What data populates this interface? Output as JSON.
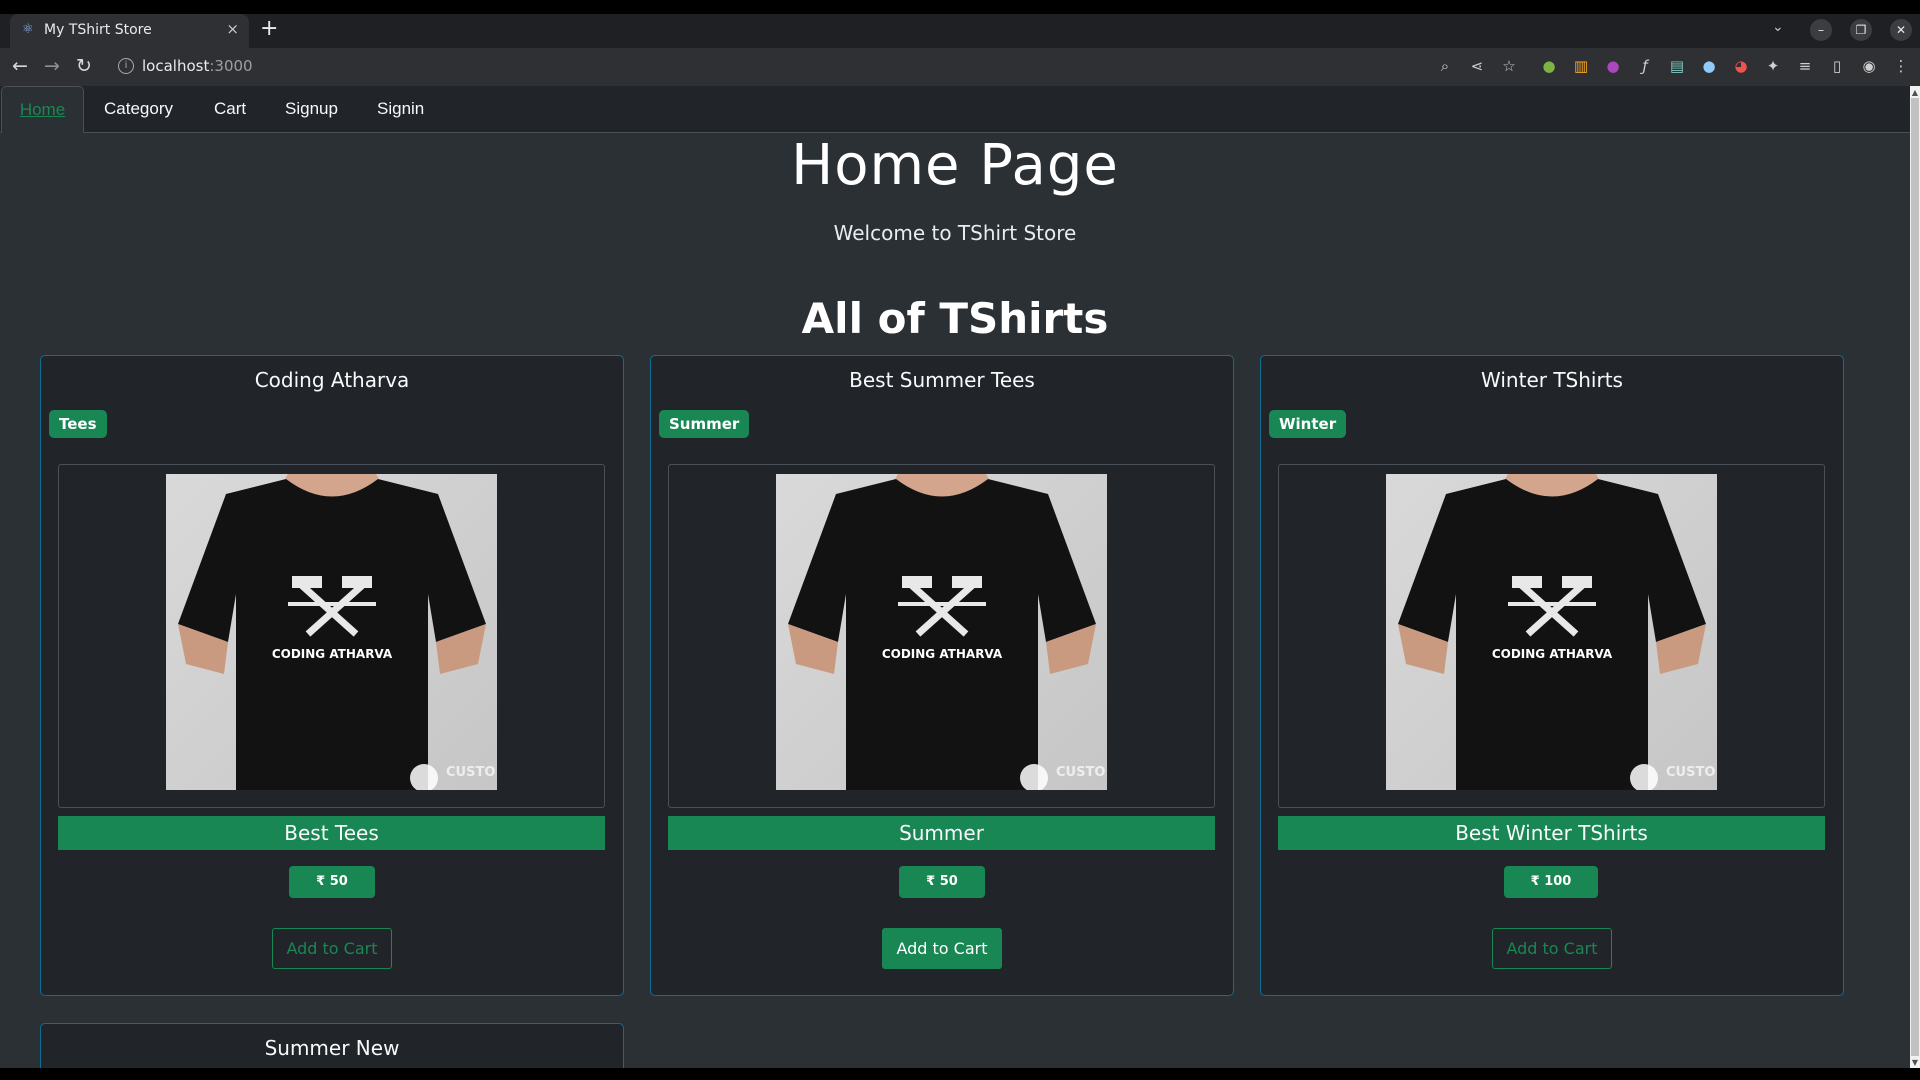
{
  "browser": {
    "tab_title": "My TShirt Store",
    "tab_close": "×",
    "new_tab": "+",
    "url_host": "localhost",
    "url_port": ":3000"
  },
  "nav": {
    "items": [
      "Home",
      "Category",
      "Cart",
      "Signup",
      "Signin"
    ]
  },
  "header": {
    "title": "Home Page",
    "subtitle": "Welcome to TShirt Store"
  },
  "section_title": "All of TShirts",
  "products": [
    {
      "name": "Coding Atharva",
      "badge": "Tees",
      "description": "Best Tees",
      "price": "₹ 50",
      "add_label": "Add to Cart",
      "image_text": "CODING ATHARVA",
      "watermark": "CUSTO INK"
    },
    {
      "name": "Best Summer Tees",
      "badge": "Summer",
      "description": "Summer",
      "price": "₹ 50",
      "add_label": "Add to Cart",
      "image_text": "CODING ATHARVA",
      "watermark": "CUSTO INK"
    },
    {
      "name": "Winter TShirts",
      "badge": "Winter",
      "description": "Best Winter TShirts",
      "price": "₹ 100",
      "add_label": "Add to Cart",
      "image_text": "CODING ATHARVA",
      "watermark": "CUSTO INK"
    },
    {
      "name": "Summer New"
    }
  ],
  "colors": {
    "accent": "#198754",
    "page_bg": "#2b3035",
    "card_bg": "#212529",
    "card_border": "#0d6e96"
  },
  "icons": [
    "back-arrow-icon",
    "forward-arrow-icon",
    "reload-icon",
    "site-info-icon",
    "zoom-icon",
    "share-icon",
    "bookmark-star-icon",
    "extension-icon"
  ]
}
